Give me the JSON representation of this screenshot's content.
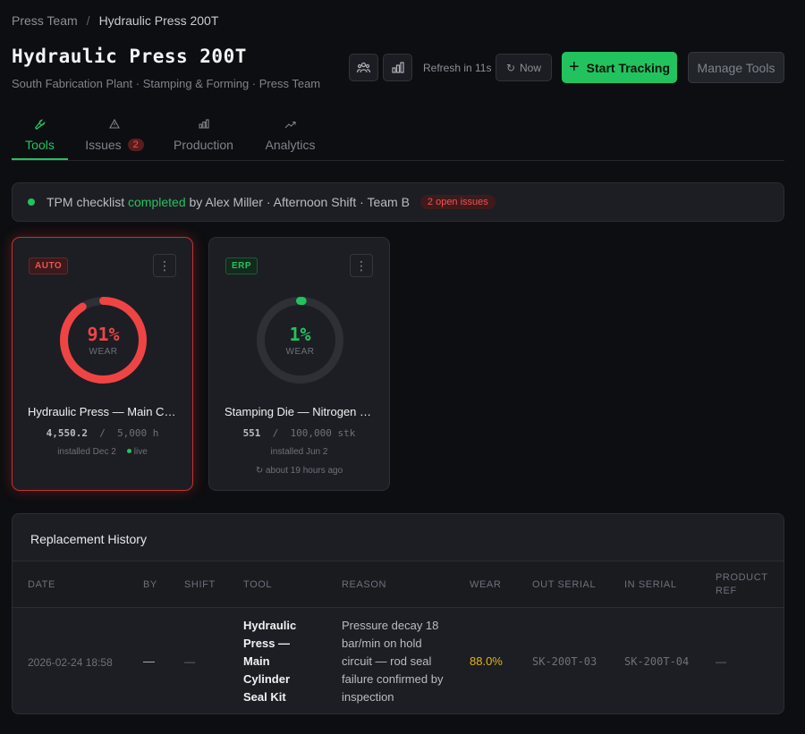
{
  "breadcrumb": {
    "parent": "Press Team",
    "separator": "/",
    "current": "Hydraulic Press 200T"
  },
  "header": {
    "title": "Hydraulic Press 200T",
    "subtitle": "South Fabrication Plant · Stamping & Forming · Press Team",
    "refresh_label": "Refresh in 11s",
    "now_label": "Now",
    "start_label": "Start Tracking",
    "manage_label": "Manage Tools"
  },
  "tabs": [
    {
      "label": "Tools",
      "icon": "wrench-icon"
    },
    {
      "label": "Issues",
      "icon": "warning-icon",
      "count": "2"
    },
    {
      "label": "Production",
      "icon": "bar-chart-icon"
    },
    {
      "label": "Analytics",
      "icon": "trend-icon"
    }
  ],
  "checklist": {
    "prefix": "TPM checklist",
    "status": "completed",
    "rest": "by Alex Miller · Afternoon Shift · Team B",
    "issues": "2 open issues"
  },
  "cards": [
    {
      "source": "AUTO",
      "percent": "91%",
      "percent_value": 91,
      "wear_label": "WEAR",
      "name": "Hydraulic Press — Main Cylinder Seal Kit",
      "current": "4,550.2",
      "separator": "/",
      "limit": "5,000 h",
      "installed": "installed Dec 2",
      "live": "live",
      "ago": ""
    },
    {
      "source": "ERP",
      "percent": "1%",
      "percent_value": 1,
      "wear_label": "WEAR",
      "name": "Stamping Die — Nitrogen Gas Spring",
      "current": "551",
      "separator": "/",
      "limit": "100,000 stk",
      "installed": "installed Jun 2",
      "live": "",
      "ago": "↻ about 19 hours ago"
    }
  ],
  "history": {
    "title": "Replacement History",
    "columns": [
      "DATE",
      "BY",
      "SHIFT",
      "TOOL",
      "REASON",
      "WEAR",
      "OUT SERIAL",
      "IN SERIAL",
      "PRODUCT REF"
    ],
    "rows": [
      {
        "date": "2026-02-24 18:58",
        "by": "—",
        "shift": "—",
        "tool": "Hydraulic Press — Main Cylinder Seal Kit",
        "reason": "Pressure decay 18 bar/min on hold circuit — rod seal failure confirmed by inspection",
        "wear": "88.0%",
        "out_serial": "SK-200T-03",
        "in_serial": "SK-200T-04",
        "product_ref": "—"
      }
    ]
  },
  "colors": {
    "accent": "#22c35e",
    "danger": "#ef4444",
    "warning": "#e0b41a",
    "background": "#0d0e11",
    "panel": "#1c1e23"
  }
}
